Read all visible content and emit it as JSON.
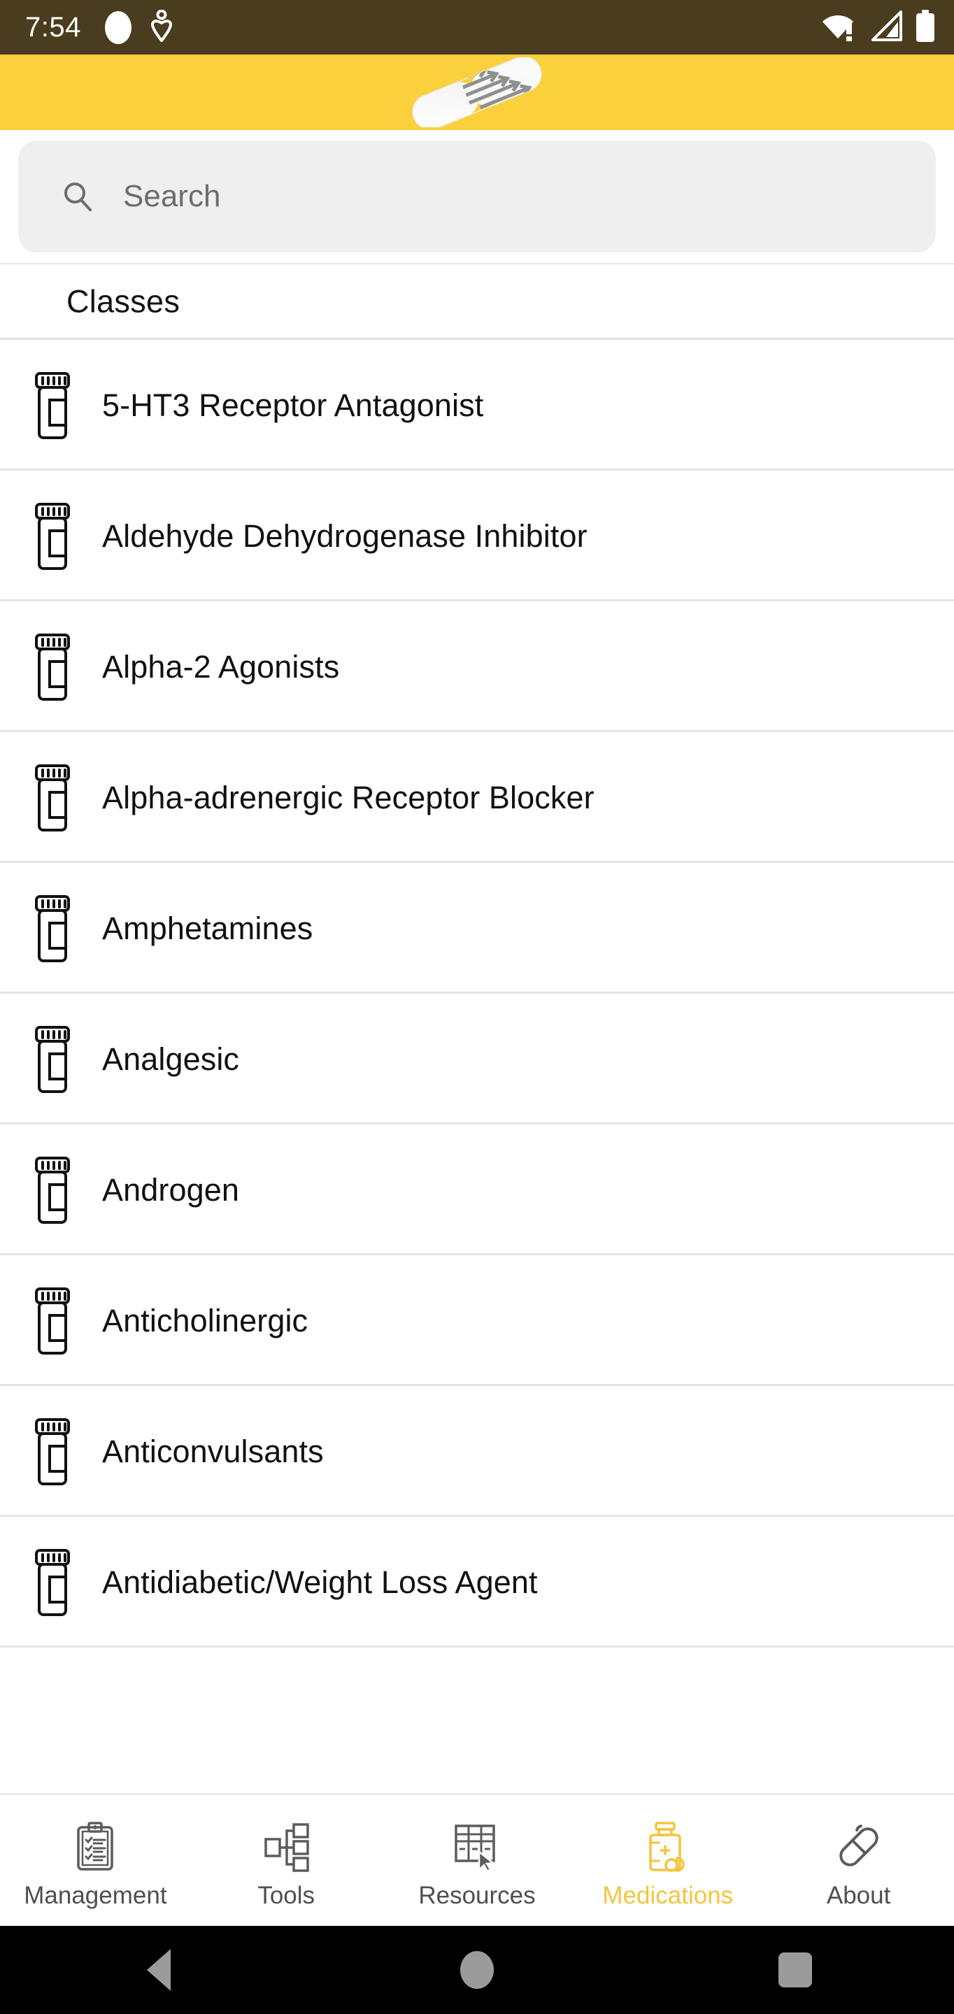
{
  "status_bar": {
    "time": "7:54",
    "left_icons": [
      "circle-indicator-icon",
      "location-pin-icon"
    ],
    "right_icons": [
      "wifi-alert-icon",
      "cell-signal-icon",
      "battery-full-icon"
    ],
    "background_color": "#4a3d1f",
    "foreground_color": "#ffffff"
  },
  "header": {
    "logo": "capsule-pill-logo",
    "background_color": "#fbd03d"
  },
  "search": {
    "placeholder": "Search",
    "value": "",
    "icon": "search-icon",
    "background_color": "#efefef"
  },
  "section": {
    "title": "Classes"
  },
  "list": {
    "row_icon": "medication-bottle-icon",
    "items": [
      {
        "label": "5-HT3 Receptor Antagonist"
      },
      {
        "label": "Aldehyde Dehydrogenase Inhibitor"
      },
      {
        "label": "Alpha-2 Agonists"
      },
      {
        "label": "Alpha-adrenergic Receptor Blocker"
      },
      {
        "label": "Amphetamines"
      },
      {
        "label": "Analgesic"
      },
      {
        "label": "Androgen"
      },
      {
        "label": "Anticholinergic"
      },
      {
        "label": "Anticonvulsants"
      },
      {
        "label": "Antidiabetic/Weight Loss Agent"
      }
    ]
  },
  "tab_bar": {
    "active_color": "#f3c53f",
    "inactive_color": "#4f4f4f",
    "tabs": [
      {
        "label": "Management",
        "icon": "clipboard-checklist-icon",
        "active": false
      },
      {
        "label": "Tools",
        "icon": "org-chart-icon",
        "active": false
      },
      {
        "label": "Resources",
        "icon": "table-cursor-icon",
        "active": false
      },
      {
        "label": "Medications",
        "icon": "pill-bottle-icon",
        "active": true
      },
      {
        "label": "About",
        "icon": "capsule-icon",
        "active": false
      }
    ]
  },
  "android_nav": {
    "buttons": [
      "back-button",
      "home-button",
      "recents-button"
    ],
    "background_color": "#000000"
  }
}
